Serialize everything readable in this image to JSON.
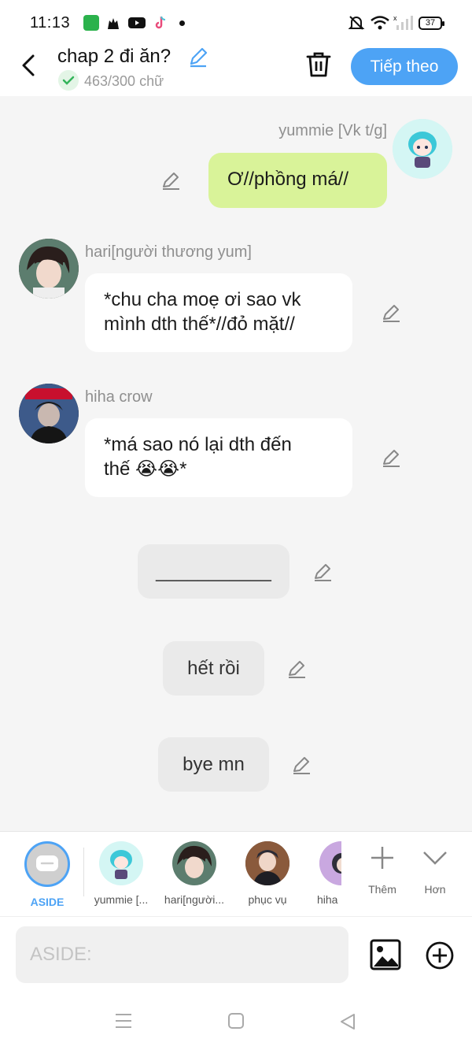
{
  "status_bar": {
    "time": "11:13",
    "battery": "37",
    "app_icons": [
      "spreadsheet-app-icon",
      "cat-app-icon",
      "youtube-icon",
      "tiktok-icon"
    ]
  },
  "header": {
    "title": "chap 2 đi ăn?",
    "word_count": "463/300 chữ",
    "next_label": "Tiếp theo"
  },
  "messages": [
    {
      "sender": "yummie [Vk t/g]",
      "text": "Ơ//phồng má//"
    },
    {
      "sender": "hari[người thương yum]",
      "text_line1": "*chu cha moẹ ơi sao vk",
      "text_line2": "mình dth thế*//đỏ mặt//"
    },
    {
      "sender": "hiha crow",
      "text_line1": "*má sao nó lại dth đến",
      "text_line2": "thế 😭😭*"
    },
    {
      "text": "___________"
    },
    {
      "text": "hết rồi"
    },
    {
      "text": "bye mn"
    }
  ],
  "character_bar": {
    "aside_label": "ASIDE",
    "characters": [
      {
        "label": "yummie [..."
      },
      {
        "label": "hari[người..."
      },
      {
        "label": "phục vụ"
      },
      {
        "label": "hiha"
      }
    ],
    "add_label": "Thêm",
    "more_label": "Hơn"
  },
  "input": {
    "placeholder": "ASIDE:"
  },
  "colors": {
    "accent": "#4da3f5",
    "own_bubble": "#d9f399",
    "other_bubble": "#ffffff",
    "narration_bubble": "#eaeaea",
    "background": "#f5f5f5"
  }
}
